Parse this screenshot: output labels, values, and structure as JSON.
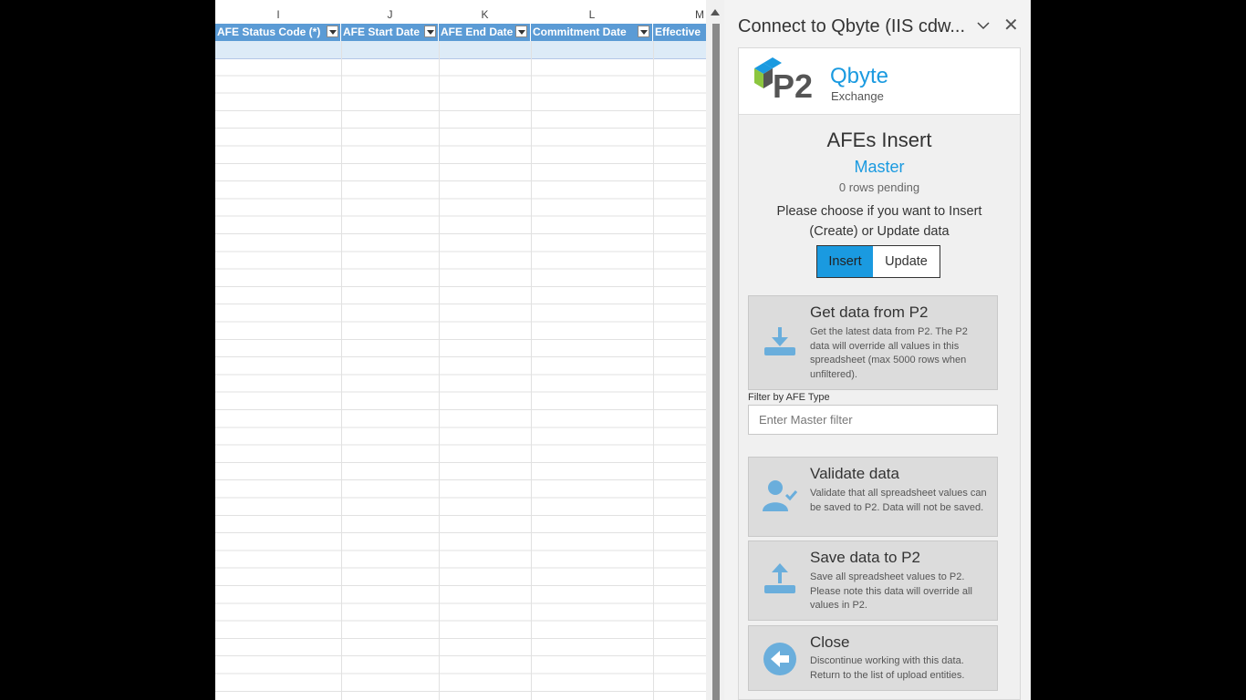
{
  "spreadsheet": {
    "columns": [
      "I",
      "J",
      "K",
      "L",
      "M"
    ],
    "headers": [
      "AFE Status Code (*)",
      "AFE Start Date",
      "AFE End Date",
      "Commitment Date",
      "Effective"
    ]
  },
  "pane": {
    "title": "Connect to Qbyte (IIS cdw...",
    "close_glyph": "✕",
    "logo": {
      "mark": "P2",
      "product": "Qbyte",
      "tagline": "Exchange"
    },
    "heading": "AFEs Insert",
    "subheading": "Master",
    "pending": "0 rows pending",
    "choose_text": "Please choose if you want to Insert (Create) or Update data",
    "toggle": {
      "insert": "Insert",
      "update": "Update",
      "selected": "Insert"
    },
    "actions": {
      "get": {
        "title": "Get data from P2",
        "desc": "Get the latest data from P2. The P2 data will override all values in this spreadsheet (max 5000 rows when unfiltered).",
        "icon": "download-icon"
      },
      "validate": {
        "title": "Validate data",
        "desc": "Validate that all spreadsheet values can be saved to P2. Data will not be saved.",
        "icon": "user-check-icon"
      },
      "save": {
        "title": "Save data to P2",
        "desc": "Save all spreadsheet values to P2. Please note this data will override all values in P2.",
        "icon": "upload-icon"
      },
      "close": {
        "title": "Close",
        "desc": "Discontinue working with this data. Return to the list of upload entities.",
        "icon": "arrow-left-circle-icon"
      }
    },
    "filter": {
      "label": "Filter by AFE Type",
      "placeholder": "Enter Master filter",
      "value": ""
    }
  },
  "colors": {
    "accent": "#1a9ae0",
    "table_header": "#5b9bd5",
    "icon": "#6aaedc"
  }
}
